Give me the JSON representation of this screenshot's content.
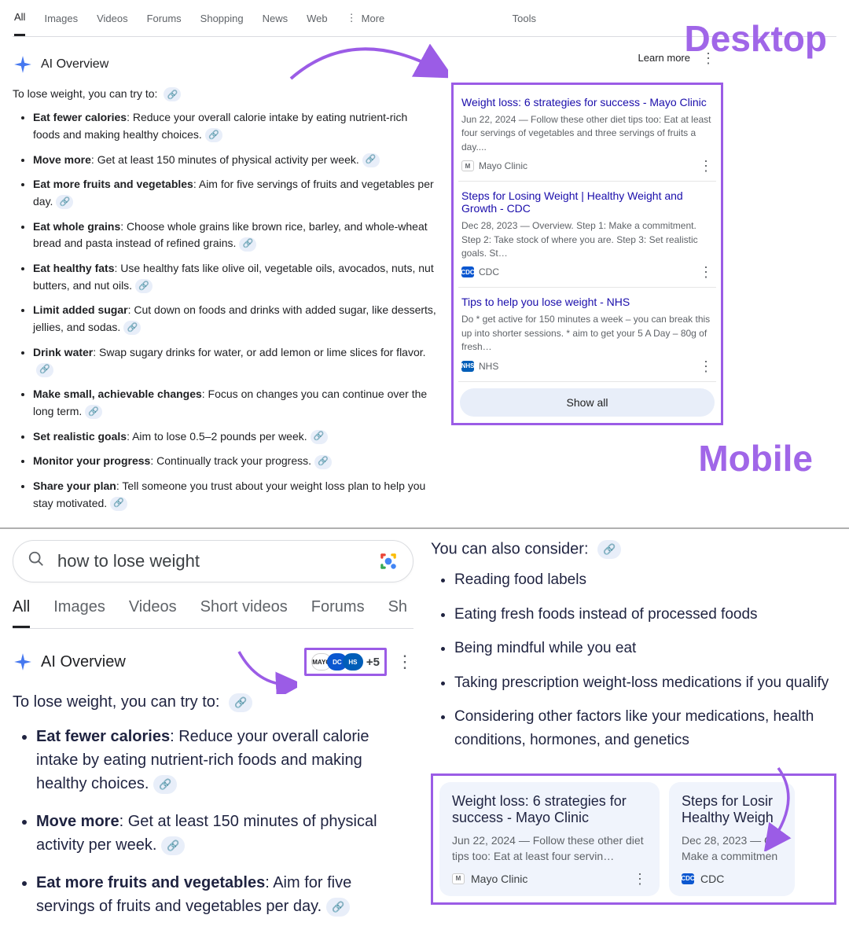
{
  "labels": {
    "desktop": "Desktop",
    "mobile": "Mobile"
  },
  "nav": {
    "tabs": [
      "All",
      "Images",
      "Videos",
      "Forums",
      "Shopping",
      "News",
      "Web"
    ],
    "more": "More",
    "tools": "Tools",
    "learn_more": "Learn more"
  },
  "ai_overview_title": "AI Overview",
  "intro": "To lose weight, you can try to:",
  "bullets": [
    {
      "bold": "Eat fewer calories",
      "rest": ": Reduce your overall calorie intake by eating nutrient-rich foods and making healthy choices."
    },
    {
      "bold": "Move more",
      "rest": ": Get at least 150 minutes of physical activity per week."
    },
    {
      "bold": "Eat more fruits and vegetables",
      "rest": ": Aim for five servings of fruits and vegetables per day."
    },
    {
      "bold": "Eat whole grains",
      "rest": ": Choose whole grains like brown rice, barley, and whole-wheat bread and pasta instead of refined grains."
    },
    {
      "bold": "Eat healthy fats",
      "rest": ": Use healthy fats like olive oil, vegetable oils, avocados, nuts, nut butters, and nut oils."
    },
    {
      "bold": "Limit added sugar",
      "rest": ": Cut down on foods and drinks with added sugar, like desserts, jellies, and sodas."
    },
    {
      "bold": "Drink water",
      "rest": ": Swap sugary drinks for water, or add lemon or lime slices for flavor."
    },
    {
      "bold": "Make small, achievable changes",
      "rest": ": Focus on changes you can continue over the long term."
    },
    {
      "bold": "Set realistic goals",
      "rest": ": Aim to lose 0.5–2 pounds per week."
    },
    {
      "bold": "Monitor your progress",
      "rest": ": Continually track your progress."
    },
    {
      "bold": "Share your plan",
      "rest": ": Tell someone you trust about your weight loss plan to help you stay motivated."
    }
  ],
  "cards": [
    {
      "title": "Weight loss: 6 strategies for success - Mayo Clinic",
      "snip": "Jun 22, 2024 — Follow these other diet tips too: Eat at least four servings of vegetables and three servings of fruits a day....",
      "src": "Mayo Clinic",
      "icon": "mayo"
    },
    {
      "title": "Steps for Losing Weight | Healthy Weight and Growth - CDC",
      "snip": "Dec 28, 2023 — Overview. Step 1: Make a commitment. Step 2: Take stock of where you are. Step 3: Set realistic goals. St…",
      "src": "CDC",
      "icon": "cdc"
    },
    {
      "title": "Tips to help you lose weight - NHS",
      "snip": "Do * get active for 150 minutes a week – you can break this up into shorter sessions. * aim to get your 5 A Day – 80g of fresh…",
      "src": "NHS",
      "icon": "nhs"
    }
  ],
  "show_all": "Show all",
  "mobile": {
    "query": "how to lose weight",
    "tabs": [
      "All",
      "Images",
      "Videos",
      "Short videos",
      "Forums",
      "Sh"
    ],
    "plus_badge": "+5",
    "bullets": [
      {
        "bold": "Eat fewer calories",
        "rest": ": Reduce your overall calorie intake by eating nutrient-rich foods and making healthy choices."
      },
      {
        "bold": "Move more",
        "rest": ": Get at least 150 minutes of physical activity per week."
      },
      {
        "bold": "Eat more fruits and vegetables",
        "rest": ": Aim for five servings of fruits and vegetables per day."
      }
    ],
    "consider_title": "You can also consider:",
    "consider": [
      "Reading food labels",
      "Eating fresh foods instead of processed foods",
      "Being mindful while you eat",
      "Taking prescription weight-loss medications if you qualify",
      "Considering other factors like your medications, health conditions, hormones, and genetics"
    ],
    "cards": [
      {
        "title": "Weight loss: 6 strategies for success - Mayo Clinic",
        "snip": "Jun 22, 2024 — Follow these other diet tips too: Eat at least four servin…",
        "src": "Mayo Clinic",
        "icon": "mayo"
      },
      {
        "title": "Steps for Losir Healthy Weigh",
        "snip": "Dec 28, 2023 — Ov Make a commitmen",
        "src": "CDC",
        "icon": "cdc"
      }
    ]
  }
}
